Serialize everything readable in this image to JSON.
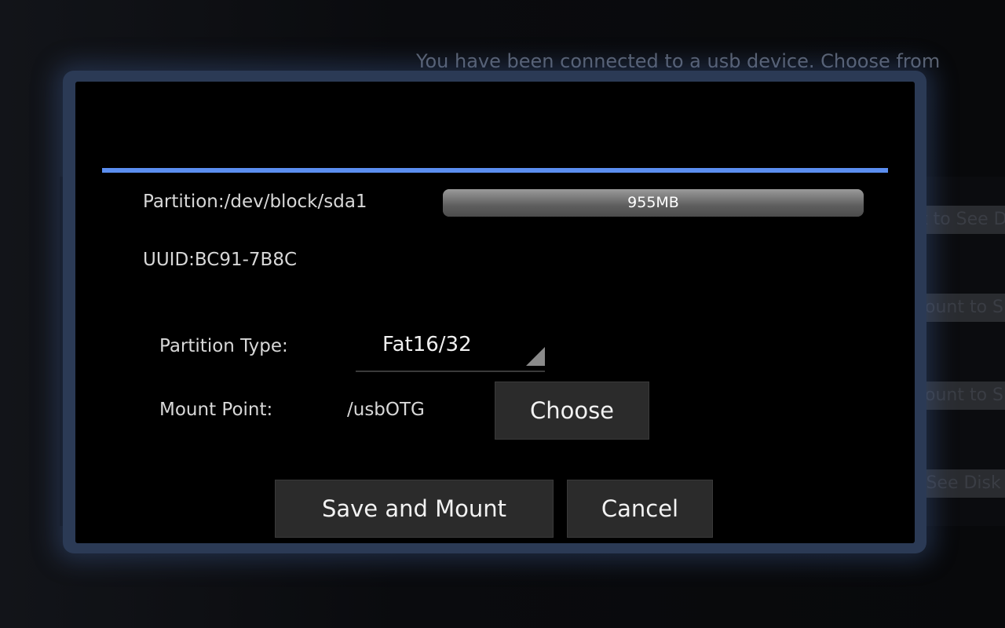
{
  "background": {
    "subtitle": "You have been connected to a usb device. Choose from",
    "rows": [
      "nt to See D",
      "Mount to S",
      "Mount to S",
      "o See Disk"
    ]
  },
  "dialog": {
    "accent_color": "#5b8ef0",
    "partition_label": "Partition:/dev/block/sda1",
    "size_bar": {
      "label": "955MB",
      "fill_percent": 100
    },
    "uuid_label": "UUID:BC91-7B8C",
    "partition_type_label": "Partition Type:",
    "partition_type_value": "Fat16/32",
    "mount_point_label": "Mount Point:",
    "mount_point_value": "/usbOTG",
    "choose_button": "Choose",
    "save_button": "Save and Mount",
    "cancel_button": "Cancel"
  }
}
